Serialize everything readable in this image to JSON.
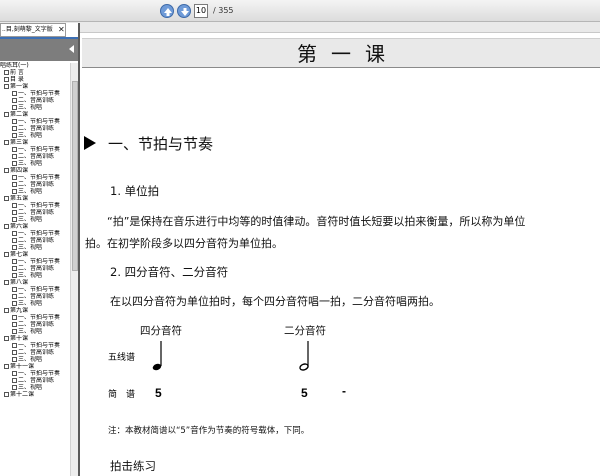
{
  "toolbar": {
    "page_current": "10",
    "page_total": "/ 355"
  },
  "sidebar": {
    "tab_label": "..目,刻萌黎_文字版",
    "close_label": "✕",
    "items": [
      {
        "level": 0,
        "box": false,
        "label": "唱练耳(一)"
      },
      {
        "level": 1,
        "box": true,
        "label": "前 言"
      },
      {
        "level": 1,
        "box": true,
        "label": "目 录"
      },
      {
        "level": 1,
        "box": true,
        "label": "第一课"
      },
      {
        "level": 2,
        "box": true,
        "label": "一、节拍与节奏"
      },
      {
        "level": 2,
        "box": true,
        "label": "二、音高训练"
      },
      {
        "level": 2,
        "box": true,
        "label": "三、视唱"
      },
      {
        "level": 1,
        "box": true,
        "label": "第二课"
      },
      {
        "level": 2,
        "box": true,
        "label": "一、节拍与节奏"
      },
      {
        "level": 2,
        "box": true,
        "label": "二、音高训练"
      },
      {
        "level": 2,
        "box": true,
        "label": "三、视唱"
      },
      {
        "level": 1,
        "box": true,
        "label": "第三课"
      },
      {
        "level": 2,
        "box": true,
        "label": "一、节拍与节奏"
      },
      {
        "level": 2,
        "box": true,
        "label": "二、音高训练"
      },
      {
        "level": 2,
        "box": true,
        "label": "三、视唱"
      },
      {
        "level": 1,
        "box": true,
        "label": "第四课"
      },
      {
        "level": 2,
        "box": true,
        "label": "一、节拍与节奏"
      },
      {
        "level": 2,
        "box": true,
        "label": "二、音高训练"
      },
      {
        "level": 2,
        "box": true,
        "label": "三、视唱"
      },
      {
        "level": 1,
        "box": true,
        "label": "第五课"
      },
      {
        "level": 2,
        "box": true,
        "label": "一、节拍与节奏"
      },
      {
        "level": 2,
        "box": true,
        "label": "二、音高训练"
      },
      {
        "level": 2,
        "box": true,
        "label": "三、视唱"
      },
      {
        "level": 1,
        "box": true,
        "label": "第六课"
      },
      {
        "level": 2,
        "box": true,
        "label": "一、节拍与节奏"
      },
      {
        "level": 2,
        "box": true,
        "label": "二、音高训练"
      },
      {
        "level": 2,
        "box": true,
        "label": "三、视唱"
      },
      {
        "level": 1,
        "box": true,
        "label": "第七课"
      },
      {
        "level": 2,
        "box": true,
        "label": "一、节拍与节奏"
      },
      {
        "level": 2,
        "box": true,
        "label": "二、音高训练"
      },
      {
        "level": 2,
        "box": true,
        "label": "三、视唱"
      },
      {
        "level": 1,
        "box": true,
        "label": "第八课"
      },
      {
        "level": 2,
        "box": true,
        "label": "一、节拍与节奏"
      },
      {
        "level": 2,
        "box": true,
        "label": "二、音高训练"
      },
      {
        "level": 2,
        "box": true,
        "label": "三、视唱"
      },
      {
        "level": 1,
        "box": true,
        "label": "第九课"
      },
      {
        "level": 2,
        "box": true,
        "label": "一、节拍与节奏"
      },
      {
        "level": 2,
        "box": true,
        "label": "二、音高训练"
      },
      {
        "level": 2,
        "box": true,
        "label": "三、视唱"
      },
      {
        "level": 1,
        "box": true,
        "label": "第十课"
      },
      {
        "level": 2,
        "box": true,
        "label": "一、节拍与节奏"
      },
      {
        "level": 2,
        "box": true,
        "label": "二、音高训练"
      },
      {
        "level": 2,
        "box": true,
        "label": "三、视唱"
      },
      {
        "level": 1,
        "box": true,
        "label": "第十一课"
      },
      {
        "level": 2,
        "box": true,
        "label": "一、节拍与节奏"
      },
      {
        "level": 2,
        "box": true,
        "label": "二、音高训练"
      },
      {
        "level": 2,
        "box": true,
        "label": "三、视唱"
      },
      {
        "level": 1,
        "box": true,
        "label": "第十二课"
      }
    ]
  },
  "doc": {
    "lesson_title": "第一课",
    "section_title": "一、节拍与节奏",
    "sub1_title": "1. 单位拍",
    "sub1_para_line1": "“拍”是保持在音乐进行中均等的时值律动。音符时值长短要以拍来衡量，所以称为单位",
    "sub1_para_line2": "拍。在初学阶段多以四分音符为单位拍。",
    "sub2_title": "2. 四分音符、二分音符",
    "sub2_para": "在以四分音符为单位拍时，每个四分音符唱一拍，二分音符唱两拍。",
    "quarter_label": "四分音符",
    "half_label": "二分音符",
    "staff_label": "五线谱",
    "jianpu_label": "简　谱",
    "jianpu_quarter": "5",
    "jianpu_half": "5",
    "jianpu_dash": "-",
    "note": "注：本教材简谱以“5”音作为节奏的符号载体，下同。",
    "practice_title": "拍击练习"
  },
  "colors": {
    "nav_blue": "#6f9bd8",
    "sidebar_border": "#5a5a5a",
    "title_bar": "#e9e9e9"
  }
}
